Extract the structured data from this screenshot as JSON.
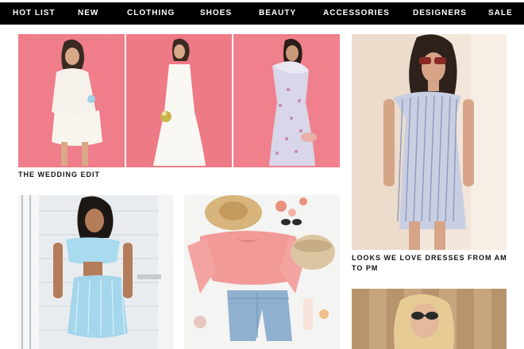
{
  "nav": {
    "items": [
      {
        "label": "HOT LIST"
      },
      {
        "label": "NEW"
      },
      {
        "label": "CLOTHING"
      },
      {
        "label": "SHOES"
      },
      {
        "label": "BEAUTY"
      },
      {
        "label": "ACCESSORIES"
      },
      {
        "label": "DESIGNERS"
      },
      {
        "label": "SALE"
      }
    ]
  },
  "tiles": {
    "wedding_edit": {
      "caption": "THE WEDDING EDIT"
    },
    "dresses_am_pm": {
      "caption": "LOOKS WE LOVE DRESSES FROM AM TO PM"
    }
  },
  "colors": {
    "nav_bg": "#000000",
    "nav_text": "#ffffff",
    "pink_backdrop": "#ee7a86",
    "cream_backdrop": "#f1e3d6"
  }
}
